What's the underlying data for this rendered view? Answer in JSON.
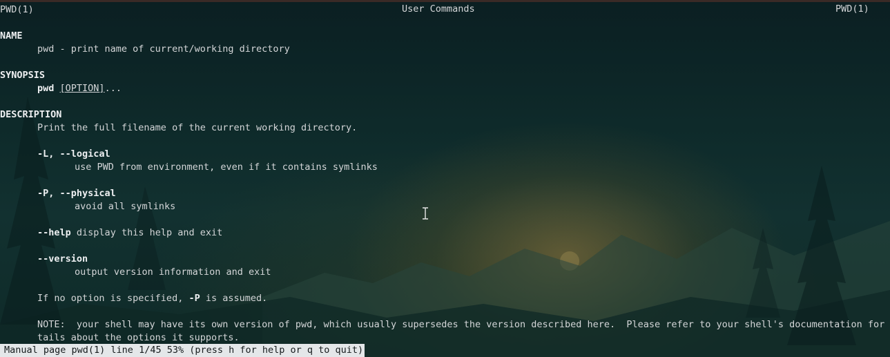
{
  "header": {
    "left": "PWD(1)",
    "center": "User Commands",
    "right": "PWD(1)"
  },
  "name": {
    "heading": "NAME",
    "text": "pwd - print name of current/working directory"
  },
  "synopsis": {
    "heading": "SYNOPSIS",
    "command": "pwd",
    "option": "[OPTION]",
    "ellipsis": "..."
  },
  "description": {
    "heading": "DESCRIPTION",
    "text": "Print the full filename of the current working directory.",
    "options": [
      {
        "flag": "-L, --logical",
        "desc": "use PWD from environment, even if it contains symlinks"
      },
      {
        "flag": "-P, --physical",
        "desc": "avoid all symlinks"
      },
      {
        "flag": "--help",
        "desc": "display this help and exit"
      },
      {
        "flag": "--version",
        "desc": "output version information and exit"
      }
    ],
    "default_prefix": "If no option is specified, ",
    "default_flag": "-P",
    "default_suffix": " is assumed.",
    "note_line1": "NOTE:  your shell may have its own version of pwd, which usually supersedes the version described here.  Please refer to your shell's documentation for de-",
    "note_line2": "tails about the options it supports."
  },
  "status_bar": "Manual page pwd(1) line 1/45 53% (press h for help or q to quit)",
  "icons": {
    "cursor": "text-cursor-icon"
  }
}
